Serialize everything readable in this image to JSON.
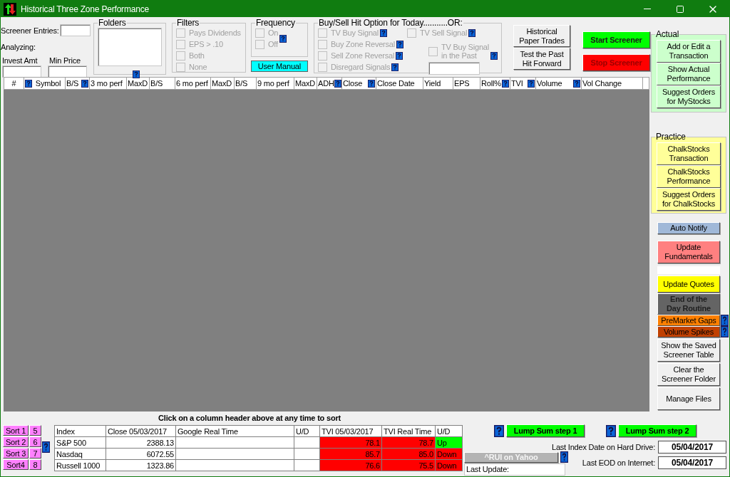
{
  "window": {
    "title": "Historical Three Zone Performance"
  },
  "screener": {
    "entries_label": "Screener Entries:",
    "analyzing_label": "Analyzing:",
    "invest_label": "Invest Amt",
    "min_price_label": "Min Price"
  },
  "folders": {
    "title": "Folders"
  },
  "filters": {
    "title": "Filters",
    "items": [
      {
        "label": "Pays Dividends",
        "checked": false,
        "disabled": true
      },
      {
        "label": "EPS > .10",
        "checked": false,
        "disabled": true
      },
      {
        "label": "Both",
        "checked": false,
        "disabled": true
      },
      {
        "label": "None",
        "checked": false,
        "disabled": true
      }
    ]
  },
  "frequency": {
    "title": "Frequency",
    "items": [
      {
        "label": "On",
        "checked": false,
        "disabled": true
      },
      {
        "label": "Off",
        "checked": false,
        "disabled": true
      }
    ]
  },
  "user_manual": "User Manual",
  "hit_options": {
    "title": "Buy/Sell Hit Option for Today...........OR:",
    "left_items": [
      {
        "label": "TV Buy Signal",
        "checked": false,
        "disabled": true
      },
      {
        "label": "Buy Zone Reversal",
        "checked": false,
        "disabled": true
      },
      {
        "label": "Sell Zone Reversal",
        "checked": false,
        "disabled": true
      },
      {
        "label": "Disregard Signals",
        "checked": false,
        "disabled": true
      }
    ],
    "right_items": [
      {
        "label": "TV Sell Signal",
        "checked": false,
        "disabled": true
      },
      {
        "label": "TV Buy Signal\nin the Past",
        "checked": false,
        "disabled": true
      }
    ]
  },
  "history_buttons": [
    "Historical\nPaper Trades",
    "Test the Past\nHit Forward"
  ],
  "screener_buttons": [
    {
      "label": "Start Screener",
      "kind": "start"
    },
    {
      "label": "Stop Screener",
      "kind": "stop"
    }
  ],
  "grid": {
    "columns": [
      "#",
      "Symbol",
      "B/S",
      "3 mo perf",
      "MaxD",
      "B/S",
      "6 mo perf",
      "MaxD",
      "B/S",
      "9 mo perf",
      "MaxD",
      "ADH",
      "Close",
      "Close Date",
      "Yield",
      "EPS",
      "Roll%",
      "TVI",
      "Volume",
      "Vol Change"
    ]
  },
  "sort_caption": "Click on a column header above at any time to sort",
  "sort_buttons": [
    {
      "label": "Sort 1",
      "number": "5"
    },
    {
      "label": "Sort 2",
      "number": "6"
    },
    {
      "label": "Sort 3",
      "number": "7"
    },
    {
      "label": "Sort4",
      "number": "8"
    }
  ],
  "index_table": {
    "columns": [
      "Index",
      "Close 05/03/2017",
      "Google Real Time",
      "U/D",
      "TVI 05/03/2017",
      "TVI Real Time",
      "U/D"
    ],
    "rows": [
      {
        "index": "S&P 500",
        "close": "2388.13",
        "tvi": "78.1",
        "tvi_real": "78.7",
        "trend": "Up",
        "color": "#00ff00"
      },
      {
        "index": "Nasdaq",
        "close": "6072.55",
        "tvi": "85.7",
        "tvi_real": "85.0",
        "trend": "Down",
        "color": "#ff0000"
      },
      {
        "index": "Russell 1000",
        "close": "1323.86",
        "tvi": "76.6",
        "tvi_real": "75.5",
        "trend": "Down",
        "color": "#ff0000"
      }
    ]
  },
  "lump_sum": [
    "Lump Sum step 1",
    "Lump Sum step 2"
  ],
  "index_date": {
    "label": "Last Index Date on Hard Drive:",
    "value": "05/04/2017"
  },
  "yahoo": {
    "label": "^RUI on Yahoo",
    "disabled": true
  },
  "last_update": "Last Update:",
  "eod_date": {
    "label": "Last EOD on Internet:",
    "value": "05/04/2017"
  },
  "actual": {
    "title": "Actual",
    "buttons": [
      "Add or Edit a\nTransaction",
      "Show Actual\nPerformance",
      "Suggest Orders\nfor MyStocks"
    ]
  },
  "practice": {
    "title": "Practice",
    "buttons": [
      "ChalkStocks\nTransaction",
      "ChalkStocks\nPerformance",
      "Suggest Orders\nfor ChalkStocks"
    ]
  },
  "tools": [
    {
      "kind": "notify",
      "label": "Auto Notify"
    },
    {
      "kind": "fundamentals",
      "label": "Update\nFundamentals"
    },
    {
      "kind": "blank"
    },
    {
      "kind": "quotes",
      "label": "Update Quotes"
    },
    {
      "kind": "eod",
      "label": "End of the\nDay Routine"
    },
    {
      "kind": "premarket",
      "label": "PreMarket Gaps"
    },
    {
      "kind": "spikes",
      "label": "Volume Spikes"
    },
    {
      "kind": "plain",
      "label": "Show the Saved\nScreener Table"
    },
    {
      "kind": "plain",
      "label": "Clear the\nScreener Folder"
    },
    {
      "kind": "plain",
      "label": "Manage Files"
    }
  ]
}
